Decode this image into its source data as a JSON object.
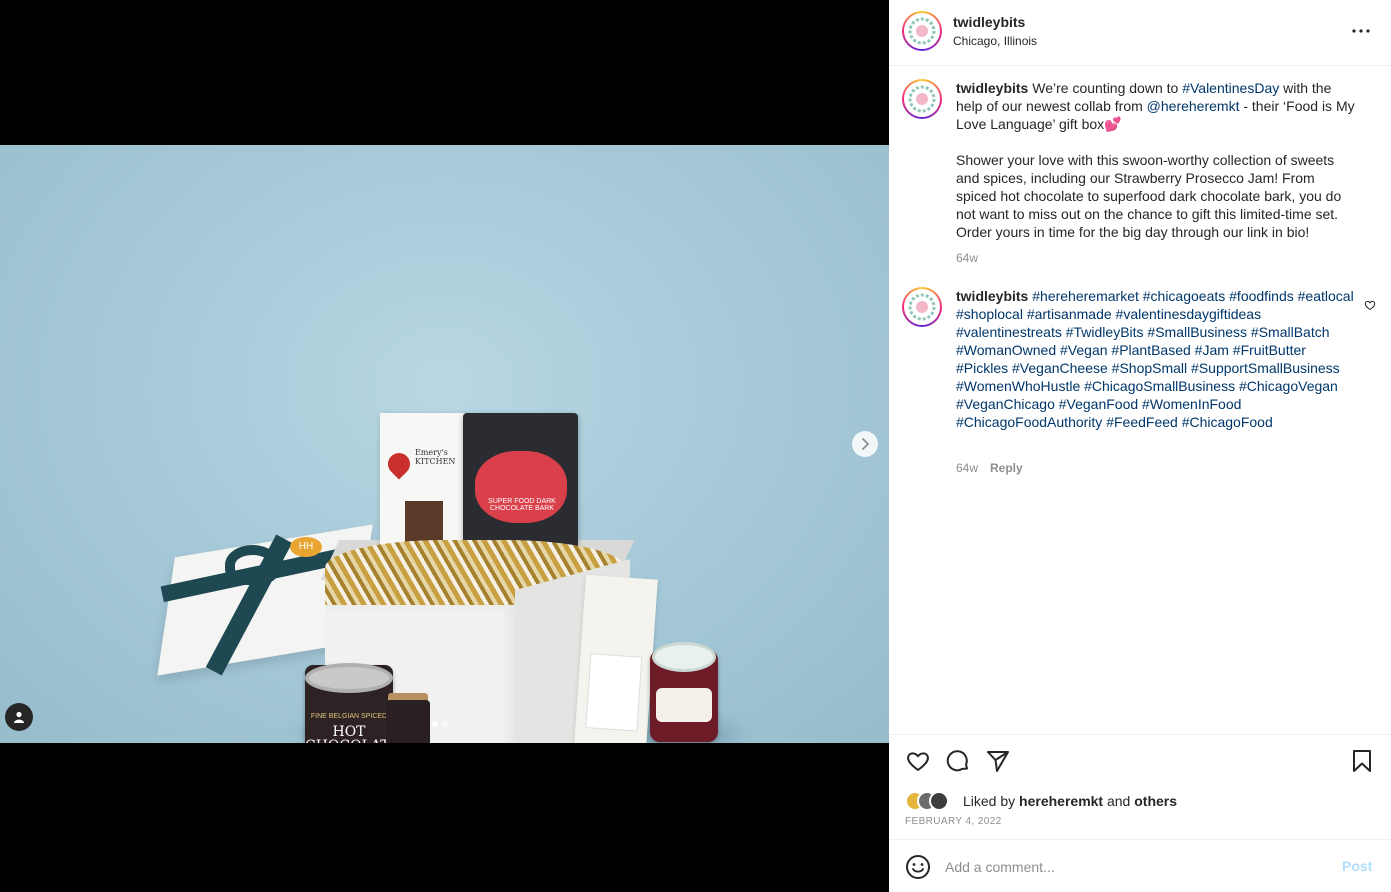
{
  "post": {
    "username": "twidleybits",
    "location": "Chicago, Illinois",
    "carousel": {
      "total_slides": 2,
      "active_slide": 1
    }
  },
  "product_labels": {
    "emerys": "Emery's KITCHEN",
    "bark": "SUPER FOOD DARK CHOCOLATE BARK",
    "tin_top": "FINE BELGIAN SPICED",
    "tin_main": "HOT CHOCOLATE",
    "badge": "HH"
  },
  "caption": {
    "username": "twidleybits",
    "text_1": " We’re counting down to ",
    "hashtag_1": "#ValentinesDay",
    "text_2": " with the help of our newest collab from ",
    "mention": "@hereheremkt",
    "text_3": " - their ‘Food is My Love Language’ gift box💕",
    "paragraph_2": "Shower your love with this swoon-worthy collection of sweets and spices, including our Strawberry Prosecco Jam! From spiced hot chocolate to superfood dark chocolate bark, you do not want to miss out on the chance to gift this limited-time set. Order yours in time for the big day through our link in bio!",
    "age": "64w"
  },
  "comment": {
    "username": "twidleybits",
    "hashtags": "#hereheremarket #chicagoeats #foodfinds #eatlocal #shoplocal #artisanmade #valentinesdaygiftideas #valentinestreats #TwidleyBits #SmallBusiness #SmallBatch #WomanOwned #Vegan #PlantBased #Jam #FruitButter #Pickles #VeganCheese #ShopSmall #SupportSmallBusiness #WomenWhoHustle #ChicagoSmallBusiness #ChicagoVegan #VeganChicago #VeganFood #WomenInFood #ChicagoFoodAuthority #FeedFeed #ChicagoFood",
    "age": "64w",
    "reply_label": "Reply"
  },
  "likes": {
    "prefix": "Liked by ",
    "liker": "hereheremkt",
    "and": " and ",
    "others": "others"
  },
  "post_date": "FEBRUARY 4, 2022",
  "add_comment": {
    "placeholder": "Add a comment...",
    "post_label": "Post"
  },
  "icons": {
    "header_more": "more-horizontal-icon",
    "next": "chevron-right-icon",
    "tag": "user-tag-icon",
    "like": "heart-icon",
    "comment": "comment-icon",
    "share": "paper-plane-icon",
    "save": "bookmark-icon",
    "emoji": "emoji-icon"
  },
  "colors": {
    "link": "#00376b",
    "muted": "#8e8e8e",
    "post_disabled": "#b2dffc",
    "photo_bg": "#a7cad9"
  }
}
